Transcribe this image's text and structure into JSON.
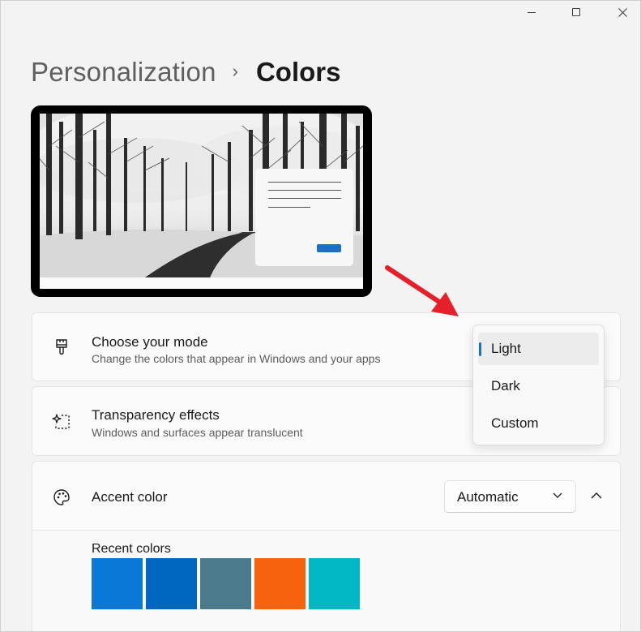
{
  "window": {
    "controls": {
      "minimize": "minimize-icon",
      "maximize": "maximize-icon",
      "close": "close-icon"
    }
  },
  "breadcrumb": {
    "parent": "Personalization",
    "separator": "›",
    "current": "Colors"
  },
  "mode_card": {
    "icon": "paintbrush-icon",
    "title": "Choose your mode",
    "description": "Change the colors that appear in Windows and your apps"
  },
  "transparency_card": {
    "icon": "sparkle-select-icon",
    "title": "Transparency effects",
    "description": "Windows and surfaces appear translucent"
  },
  "accent_card": {
    "icon": "palette-icon",
    "title": "Accent color",
    "dropdown_value": "Automatic",
    "recent_colors_label": "Recent colors",
    "recent_colors": [
      "#0a78d7",
      "#0067c0",
      "#4a7a8c",
      "#f7630c",
      "#00b7c3"
    ]
  },
  "mode_flyout": {
    "options": [
      "Light",
      "Dark",
      "Custom"
    ],
    "selected": "Light"
  },
  "colors": {
    "accent": "#1e6fc4",
    "annotation_arrow": "#e5202a"
  }
}
